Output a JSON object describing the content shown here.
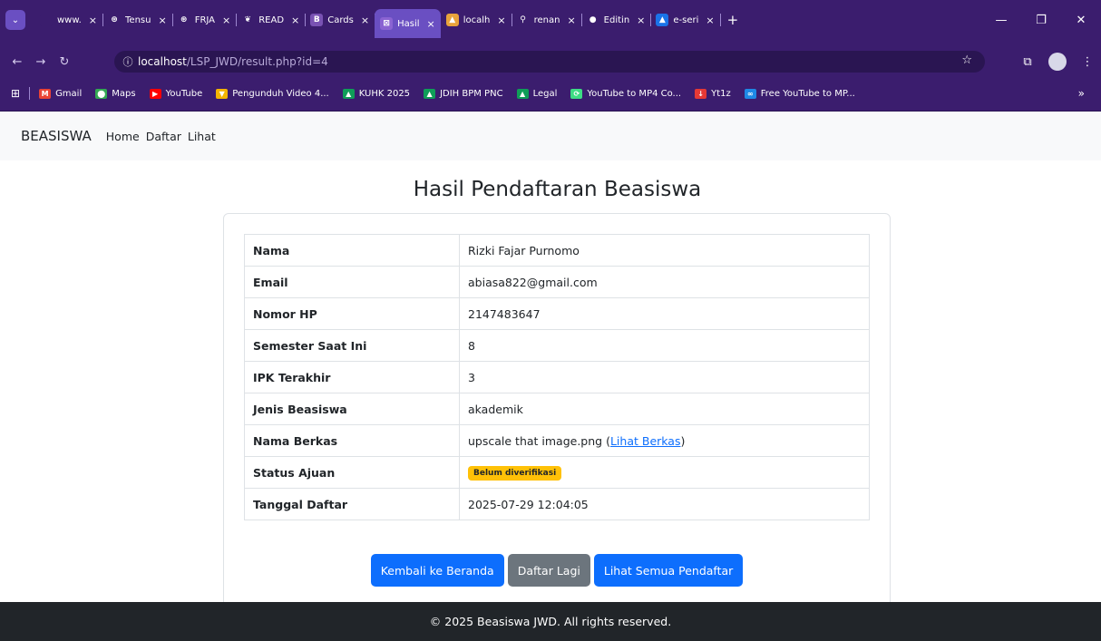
{
  "browser": {
    "tabs": [
      {
        "title": "www.",
        "favicon_color": "#3b1d6e",
        "favicon_text": "",
        "active": false
      },
      {
        "title": "Tensu",
        "favicon_color": "#3b1d6e",
        "favicon_text": "⊛",
        "active": false
      },
      {
        "title": "FRJA",
        "favicon_color": "#3b1d6e",
        "favicon_text": "⊛",
        "active": false
      },
      {
        "title": "READ",
        "favicon_color": "#3b1d6e",
        "favicon_text": "❦",
        "active": false
      },
      {
        "title": "Cards",
        "favicon_color": "#7952b3",
        "favicon_text": "B",
        "active": false
      },
      {
        "title": "Hasil",
        "favicon_color": "#8a63d2",
        "favicon_text": "⊠",
        "active": true
      },
      {
        "title": "localh",
        "favicon_color": "#e8a33c",
        "favicon_text": "▲",
        "active": false
      },
      {
        "title": "renan",
        "favicon_color": "#3b1d6e",
        "favicon_text": "⚲",
        "active": false
      },
      {
        "title": "Editin",
        "favicon_color": "#3b1d6e",
        "favicon_text": "●",
        "active": false
      },
      {
        "title": "e-seri",
        "favicon_color": "#1a73e8",
        "favicon_text": "▲",
        "active": false
      }
    ],
    "close_glyph": "×",
    "add_tab": "+",
    "url_host": "localhost",
    "url_path": "/LSP_JWD/result.php?id=4",
    "bookmarks": [
      {
        "label": "Gmail",
        "color": "#ea4335",
        "glyph": "M"
      },
      {
        "label": "Maps",
        "color": "#34a853",
        "glyph": "⬤"
      },
      {
        "label": "YouTube",
        "color": "#ff0000",
        "glyph": "▶"
      },
      {
        "label": "Pengunduh Video 4...",
        "color": "#f4b400",
        "glyph": "▼"
      },
      {
        "label": "KUHK 2025",
        "color": "#0f9d58",
        "glyph": "▲"
      },
      {
        "label": "JDIH BPM PNC",
        "color": "#0f9d58",
        "glyph": "▲"
      },
      {
        "label": "Legal",
        "color": "#0f9d58",
        "glyph": "▲"
      },
      {
        "label": "YouTube to MP4 Co...",
        "color": "#3ddc84",
        "glyph": "⟳"
      },
      {
        "label": "Yt1z",
        "color": "#e53935",
        "glyph": "↓"
      },
      {
        "label": "Free YouTube to MP...",
        "color": "#1e88e5",
        "glyph": "∞"
      }
    ],
    "bookmarks_more": "»"
  },
  "navbar": {
    "brand": "BEASISWA",
    "links": [
      "Home",
      "Daftar",
      "Lihat"
    ]
  },
  "main": {
    "title": "Hasil Pendaftaran Beasiswa",
    "rows": [
      {
        "label": "Nama",
        "value": "Rizki Fajar Purnomo"
      },
      {
        "label": "Email",
        "value": "abiasa822@gmail.com"
      },
      {
        "label": "Nomor HP",
        "value": "2147483647"
      },
      {
        "label": "Semester Saat Ini",
        "value": "8"
      },
      {
        "label": "IPK Terakhir",
        "value": "3"
      },
      {
        "label": "Jenis Beasiswa",
        "value": "akademik"
      }
    ],
    "berkas": {
      "label": "Nama Berkas",
      "filename": "upscale that image.png",
      "open_paren": " (",
      "link": "Lihat Berkas",
      "close_paren": ")"
    },
    "status": {
      "label": "Status Ajuan",
      "badge": "Belum diverifikasi",
      "badge_color": "#ffc107"
    },
    "tanggal": {
      "label": "Tanggal Daftar",
      "value": "2025-07-29 12:04:05"
    },
    "buttons": {
      "home": "Kembali ke Beranda",
      "daftar": "Daftar Lagi",
      "lihat": "Lihat Semua Pendaftar"
    }
  },
  "footer": {
    "text": "© 2025 Beasiswa JWD. All rights reserved."
  }
}
